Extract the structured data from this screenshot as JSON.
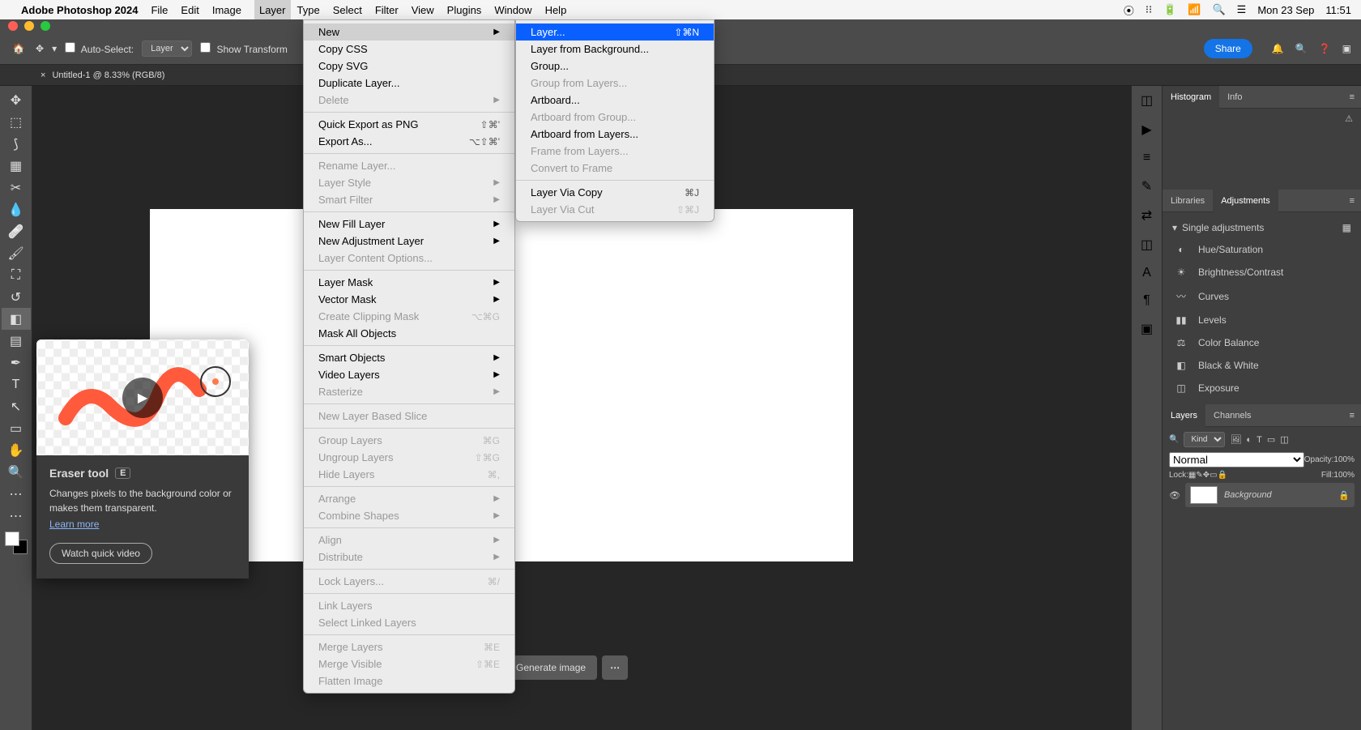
{
  "menubar": {
    "app_name": "Adobe Photoshop 2024",
    "items": [
      "File",
      "Edit",
      "Image",
      "Layer",
      "Type",
      "Select",
      "Filter",
      "View",
      "Plugins",
      "Window",
      "Help"
    ],
    "right": {
      "date": "Mon 23 Sep",
      "time": "11:51"
    }
  },
  "options_bar": {
    "auto_select_label": "Auto-Select:",
    "auto_select_value": "Layer",
    "show_transform_label": "Show Transform",
    "share_label": "Share"
  },
  "doc_tab": {
    "title": "Untitled-1 @ 8.33% (RGB/8)"
  },
  "tooltip": {
    "title": "Eraser tool",
    "key": "E",
    "desc": "Changes pixels to the background color or makes them transparent.",
    "learn": "Learn more",
    "watch": "Watch quick video"
  },
  "gen_button": "Generate image",
  "layer_menu": [
    {
      "label": "New",
      "arrow": true
    },
    {
      "label": "Copy CSS"
    },
    {
      "label": "Copy SVG"
    },
    {
      "label": "Duplicate Layer..."
    },
    {
      "label": "Delete",
      "arrow": true,
      "disabled": true
    },
    {
      "sep": true
    },
    {
      "label": "Quick Export as PNG",
      "shortcut": "⇧⌘'"
    },
    {
      "label": "Export As...",
      "shortcut": "⌥⇧⌘'"
    },
    {
      "sep": true
    },
    {
      "label": "Rename Layer...",
      "disabled": true
    },
    {
      "label": "Layer Style",
      "arrow": true,
      "disabled": true
    },
    {
      "label": "Smart Filter",
      "arrow": true,
      "disabled": true
    },
    {
      "sep": true
    },
    {
      "label": "New Fill Layer",
      "arrow": true
    },
    {
      "label": "New Adjustment Layer",
      "arrow": true
    },
    {
      "label": "Layer Content Options...",
      "disabled": true
    },
    {
      "sep": true
    },
    {
      "label": "Layer Mask",
      "arrow": true
    },
    {
      "label": "Vector Mask",
      "arrow": true
    },
    {
      "label": "Create Clipping Mask",
      "shortcut": "⌥⌘G",
      "disabled": true
    },
    {
      "label": "Mask All Objects"
    },
    {
      "sep": true
    },
    {
      "label": "Smart Objects",
      "arrow": true
    },
    {
      "label": "Video Layers",
      "arrow": true
    },
    {
      "label": "Rasterize",
      "arrow": true,
      "disabled": true
    },
    {
      "sep": true
    },
    {
      "label": "New Layer Based Slice",
      "disabled": true
    },
    {
      "sep": true
    },
    {
      "label": "Group Layers",
      "shortcut": "⌘G",
      "disabled": true
    },
    {
      "label": "Ungroup Layers",
      "shortcut": "⇧⌘G",
      "disabled": true
    },
    {
      "label": "Hide Layers",
      "shortcut": "⌘,",
      "disabled": true
    },
    {
      "sep": true
    },
    {
      "label": "Arrange",
      "arrow": true,
      "disabled": true
    },
    {
      "label": "Combine Shapes",
      "arrow": true,
      "disabled": true
    },
    {
      "sep": true
    },
    {
      "label": "Align",
      "arrow": true,
      "disabled": true
    },
    {
      "label": "Distribute",
      "arrow": true,
      "disabled": true
    },
    {
      "sep": true
    },
    {
      "label": "Lock Layers...",
      "shortcut": "⌘/",
      "disabled": true
    },
    {
      "sep": true
    },
    {
      "label": "Link Layers",
      "disabled": true
    },
    {
      "label": "Select Linked Layers",
      "disabled": true
    },
    {
      "sep": true
    },
    {
      "label": "Merge Layers",
      "shortcut": "⌘E",
      "disabled": true
    },
    {
      "label": "Merge Visible",
      "shortcut": "⇧⌘E",
      "disabled": true
    },
    {
      "label": "Flatten Image",
      "disabled": true
    }
  ],
  "new_submenu": [
    {
      "label": "Layer...",
      "shortcut": "⇧⌘N",
      "highlight": true
    },
    {
      "label": "Layer from Background..."
    },
    {
      "label": "Group..."
    },
    {
      "label": "Group from Layers...",
      "disabled": true
    },
    {
      "label": "Artboard..."
    },
    {
      "label": "Artboard from Group...",
      "disabled": true
    },
    {
      "label": "Artboard from Layers..."
    },
    {
      "label": "Frame from Layers...",
      "disabled": true
    },
    {
      "label": "Convert to Frame",
      "disabled": true
    },
    {
      "sep": true
    },
    {
      "label": "Layer Via Copy",
      "shortcut": "⌘J"
    },
    {
      "label": "Layer Via Cut",
      "shortcut": "⇧⌘J",
      "disabled": true
    }
  ],
  "panels": {
    "histogram_tab": "Histogram",
    "info_tab": "Info",
    "libraries_tab": "Libraries",
    "adjustments_tab": "Adjustments",
    "adj_header": "Single adjustments",
    "adj_items": [
      "Hue/Saturation",
      "Brightness/Contrast",
      "Curves",
      "Levels",
      "Color Balance",
      "Black & White",
      "Exposure"
    ],
    "layers_tab": "Layers",
    "channels_tab": "Channels",
    "kind_label": "Kind",
    "blend_mode": "Normal",
    "opacity_label": "Opacity:",
    "opacity_value": "100%",
    "lock_label": "Lock:",
    "fill_label": "Fill:",
    "fill_value": "100%",
    "bg_layer": "Background"
  }
}
